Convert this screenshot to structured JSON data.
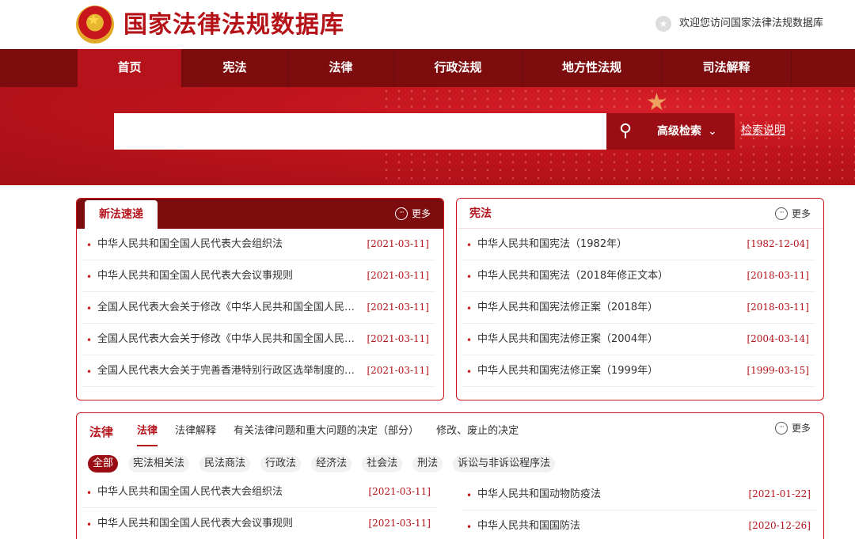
{
  "header": {
    "title": "国家法律法规数据库",
    "welcome": "欢迎您访问国家法律法规数据库"
  },
  "nav": {
    "items": [
      {
        "label": "首页",
        "active": true
      },
      {
        "label": "宪法"
      },
      {
        "label": "法律"
      },
      {
        "label": "行政法规"
      },
      {
        "label": "地方性法规"
      },
      {
        "label": "司法解释"
      }
    ]
  },
  "search": {
    "value": "",
    "advanced_label": "高级检索",
    "help_label": "检索说明"
  },
  "new_laws": {
    "title": "新法速递",
    "more": "更多",
    "items": [
      {
        "title": "中华人民共和国全国人民代表大会组织法",
        "date": "[2021-03-11]"
      },
      {
        "title": "中华人民共和国全国人民代表大会议事规则",
        "date": "[2021-03-11]"
      },
      {
        "title": "全国人民代表大会关于修改《中华人民共和国全国人民…",
        "date": "[2021-03-11]"
      },
      {
        "title": "全国人民代表大会关于修改《中华人民共和国全国人民…",
        "date": "[2021-03-11]"
      },
      {
        "title": "全国人民代表大会关于完善香港特别行政区选举制度的…",
        "date": "[2021-03-11]"
      }
    ]
  },
  "constitution": {
    "title": "宪法",
    "more": "更多",
    "items": [
      {
        "title": "中华人民共和国宪法（1982年）",
        "date": "[1982-12-04]"
      },
      {
        "title": "中华人民共和国宪法（2018年修正文本）",
        "date": "[2018-03-11]"
      },
      {
        "title": "中华人民共和国宪法修正案（2018年）",
        "date": "[2018-03-11]"
      },
      {
        "title": "中华人民共和国宪法修正案（2004年）",
        "date": "[2004-03-14]"
      },
      {
        "title": "中华人民共和国宪法修正案（1999年）",
        "date": "[1999-03-15]"
      }
    ]
  },
  "laws": {
    "section_title": "法律",
    "more": "更多",
    "tabs": [
      {
        "label": "法律",
        "active": true
      },
      {
        "label": "法律解释"
      },
      {
        "label": "有关法律问题和重大问题的决定（部分）"
      },
      {
        "label": "修改、废止的决定"
      }
    ],
    "categories": [
      {
        "label": "全部",
        "active": true
      },
      {
        "label": "宪法相关法"
      },
      {
        "label": "民法商法"
      },
      {
        "label": "行政法"
      },
      {
        "label": "经济法"
      },
      {
        "label": "社会法"
      },
      {
        "label": "刑法"
      },
      {
        "label": "诉讼与非诉讼程序法"
      }
    ],
    "left_items": [
      {
        "title": "中华人民共和国全国人民代表大会组织法",
        "date": "[2021-03-11]"
      },
      {
        "title": "中华人民共和国全国人民代表大会议事规则",
        "date": "[2021-03-11]"
      }
    ],
    "right_items": [
      {
        "title": "中华人民共和国动物防疫法",
        "date": "[2021-01-22]"
      },
      {
        "title": "中华人民共和国国防法",
        "date": "[2020-12-26]"
      }
    ]
  }
}
